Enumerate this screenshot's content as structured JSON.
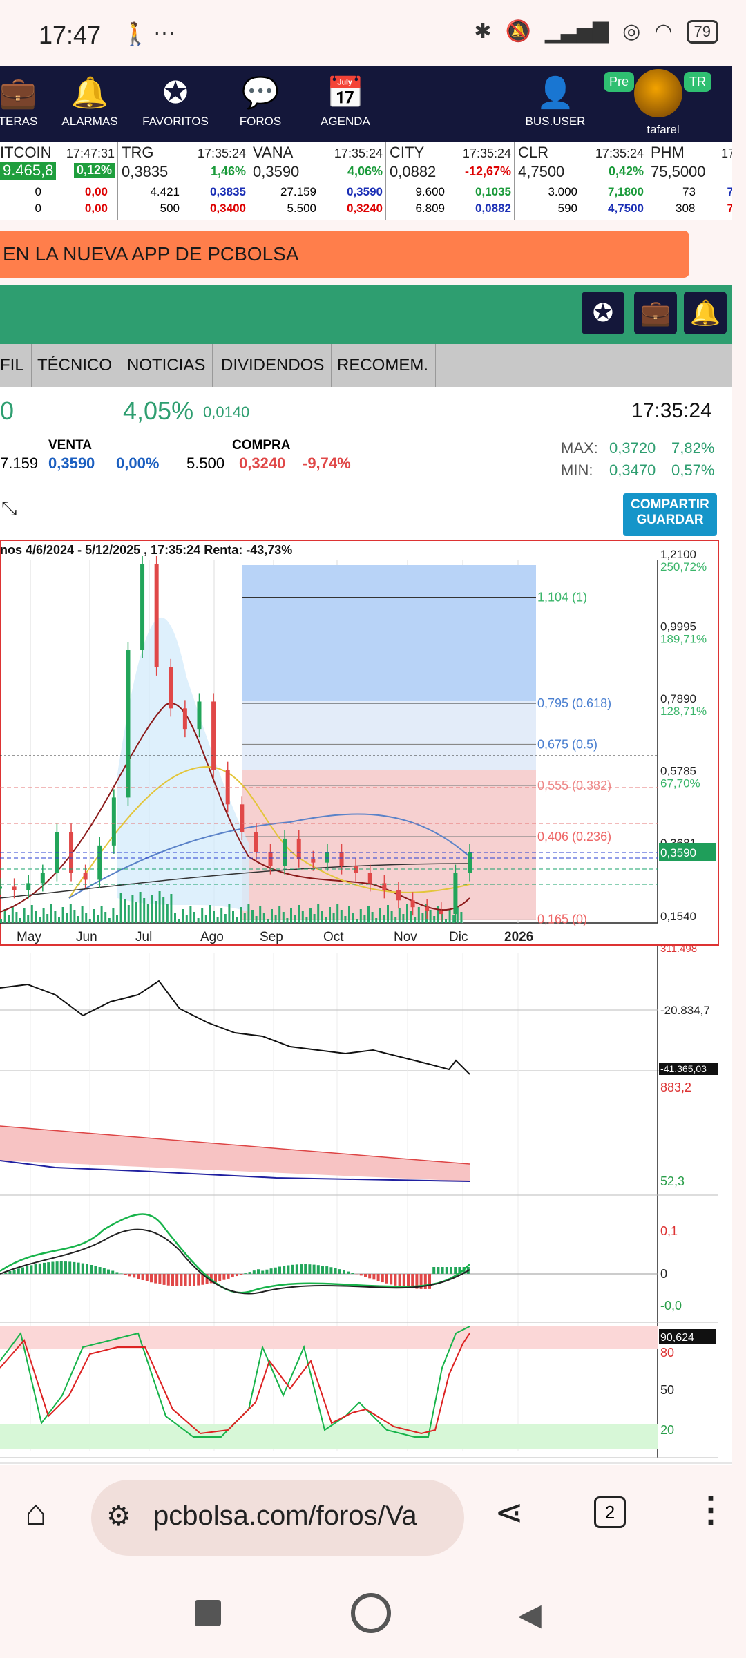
{
  "status_bar": {
    "time": "17:47",
    "battery": "79"
  },
  "nav": {
    "items": [
      {
        "label": "TERAS",
        "icon": "briefcase-icon"
      },
      {
        "label": "ALARMAS",
        "icon": "bell-icon"
      },
      {
        "label": "FAVORITOS",
        "icon": "star-icon"
      },
      {
        "label": "FOROS",
        "icon": "chat-icon"
      },
      {
        "label": "AGENDA",
        "icon": "calendar-icon"
      }
    ],
    "bususer": "BUS.USER",
    "user": "tafarel",
    "badge_pre": "Pre",
    "badge_tr": "TR"
  },
  "ticker": [
    {
      "name": "ITCOIN",
      "time": "17:47:31",
      "price": "9.465,8",
      "change": "0,12%",
      "r1": [
        "0",
        "0,00"
      ],
      "r2": [
        "0",
        "0,00"
      ]
    },
    {
      "name": "TRG",
      "time": "17:35:24",
      "price": "0,3835",
      "change": "1,46%",
      "r1": [
        "4.421",
        "0,3835"
      ],
      "r2": [
        "500",
        "0,3400"
      ]
    },
    {
      "name": "VANA",
      "time": "17:35:24",
      "price": "0,3590",
      "change": "4,06%",
      "r1": [
        "27.159",
        "0,3590"
      ],
      "r2": [
        "5.500",
        "0,3240"
      ]
    },
    {
      "name": "CITY",
      "time": "17:35:24",
      "price": "0,0882",
      "change": "-12,67%",
      "r1": [
        "9.600",
        "0,1035"
      ],
      "r2": [
        "6.809",
        "0,0882"
      ]
    },
    {
      "name": "CLR",
      "time": "17:35:24",
      "price": "4,7500",
      "change": "0,42%",
      "r1": [
        "3.000",
        "7,1800"
      ],
      "r2": [
        "590",
        "4,7500"
      ]
    },
    {
      "name": "PHM",
      "time": "17",
      "price": "75,5000",
      "change": "",
      "r1": [
        "73",
        "7"
      ],
      "r2": [
        "308",
        "7"
      ]
    }
  ],
  "banner": "EN LA NUEVA APP DE PCBOLSA",
  "tabs": [
    "FIL",
    "TÉCNICO",
    "NOTICIAS",
    "DIVIDENDOS",
    "RECOMEM."
  ],
  "quote": {
    "price_frag": "0",
    "change_pct": "4,05%",
    "change_abs": "0,0140",
    "time": "17:35:24",
    "venta_label": "VENTA",
    "compra_label": "COMPRA",
    "venta_vol": "7.159",
    "venta_price": "0,3590",
    "venta_pct": "0,00%",
    "compra_vol": "5.500",
    "compra_price": "0,3240",
    "compra_pct": "-9,74%",
    "max_label": "MAX:",
    "max_val": "0,3720",
    "max_pct": "7,82%",
    "min_label": "MIN:",
    "min_val": "0,3470",
    "min_pct": "0,57%",
    "share_btn_1": "COMPARTIR",
    "share_btn_2": "GUARDAR"
  },
  "chart_data": {
    "type": "line",
    "title": "nos 4/6/2024 - 5/12/2025 , 17:35:24 Renta: -43,73%",
    "x": [
      "May",
      "Jun",
      "Jul",
      "Ago",
      "Sep",
      "Oct",
      "Nov",
      "Dic",
      "2026"
    ],
    "price_labels": [
      "1,2100",
      "0,9995",
      "0,7890",
      "0,5785",
      "0,3681",
      "0,1540"
    ],
    "pct_labels": [
      "250,72%",
      "189,71%",
      "128,71%",
      "67,70%"
    ],
    "current_price": "0,3590",
    "fib_levels": [
      {
        "label": "1,104 (1)",
        "value": 1.104
      },
      {
        "label": "0,795 (0.618)",
        "value": 0.795
      },
      {
        "label": "0,675 (0.5)",
        "value": 0.675
      },
      {
        "label": "0,555 (0.382)",
        "value": 0.555
      },
      {
        "label": "0,406 (0.236)",
        "value": 0.406
      },
      {
        "label": "0,165 (0)",
        "value": 0.165
      }
    ],
    "series": [
      {
        "values": [
          0.26,
          0.25,
          0.27,
          0.3,
          0.42,
          0.3,
          0.28,
          0.38,
          0.52,
          0.95,
          1.2,
          0.9,
          0.78,
          0.72,
          0.8,
          0.6,
          0.5,
          0.42,
          0.36,
          0.32,
          0.4,
          0.34,
          0.33,
          0.36,
          0.32,
          0.3,
          0.27,
          0.25,
          0.22,
          0.2,
          0.19,
          0.18,
          0.3,
          0.36
        ]
      }
    ],
    "pane2_labels": [
      "-20.834,7",
      "-41.365,03",
      "311.498"
    ],
    "pane3_labels": [
      "883,2",
      "52,3"
    ],
    "pane4_labels": [
      "0,1",
      "0",
      "-0,0"
    ],
    "pane5_labels": [
      "90,624",
      "80",
      "50",
      "20"
    ]
  },
  "browser": {
    "url": "pcbolsa.com/foros/Va",
    "tabs_count": "2"
  }
}
